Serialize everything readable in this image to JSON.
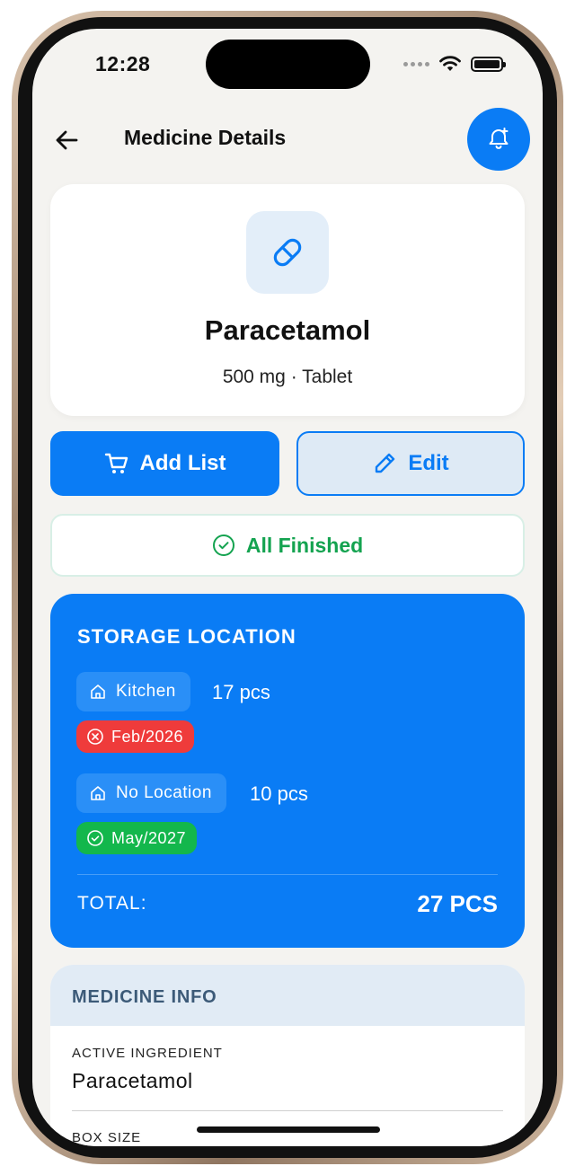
{
  "status_bar": {
    "time": "12:28"
  },
  "header": {
    "title": "Medicine Details"
  },
  "medicine": {
    "name": "Paracetamol",
    "subtitle": "500 mg · Tablet"
  },
  "actions": {
    "add_list_label": "Add List",
    "edit_label": "Edit"
  },
  "status": {
    "label": "All Finished",
    "color": "#14a350"
  },
  "storage": {
    "title": "STORAGE LOCATION",
    "locations": [
      {
        "name": "Kitchen",
        "quantity": "17 pcs",
        "expiry": "Feb/2026",
        "expiry_state": "expired",
        "expiry_icon": "x-circle-icon"
      },
      {
        "name": "No Location",
        "quantity": "10 pcs",
        "expiry": "May/2027",
        "expiry_state": "valid",
        "expiry_icon": "check-circle-icon"
      }
    ],
    "total_label": "TOTAL:",
    "total_value": "27 PCS"
  },
  "info": {
    "title": "MEDICINE INFO",
    "fields": [
      {
        "label": "ACTIVE INGREDIENT",
        "value": "Paracetamol"
      },
      {
        "label": "BOX SIZE",
        "value": ""
      }
    ]
  },
  "colors": {
    "accent": "#0a7cf5",
    "expired": "#ef3b3b",
    "valid": "#13b74c",
    "background": "#f4f3f0"
  }
}
